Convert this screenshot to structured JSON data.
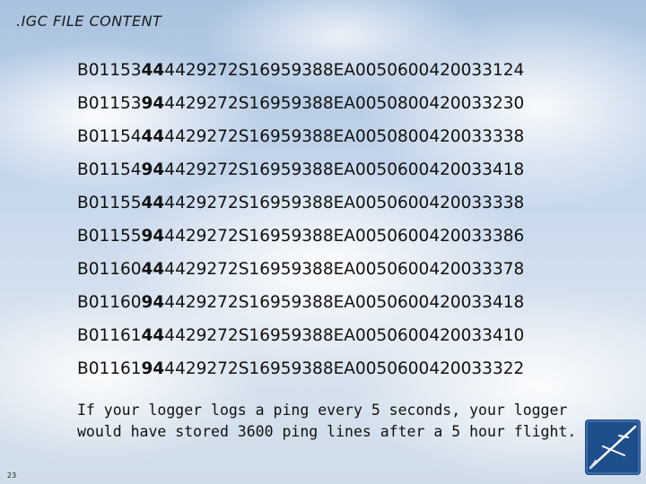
{
  "slide": {
    "title": ".IGC FILE CONTENT",
    "records": [
      {
        "prefix": "B01153",
        "bold": "44",
        "suffix": "4429272S16959388EA0050600420033124"
      },
      {
        "prefix": "B01153",
        "bold": "94",
        "suffix": "4429272S16959388EA0050800420033230"
      },
      {
        "prefix": "B01154",
        "bold": "44",
        "suffix": "4429272S16959388EA0050800420033338"
      },
      {
        "prefix": "B01154",
        "bold": "94",
        "suffix": "4429272S16959388EA0050600420033418"
      },
      {
        "prefix": "B01155",
        "bold": "44",
        "suffix": "4429272S16959388EA0050600420033338"
      },
      {
        "prefix": "B01155",
        "bold": "94",
        "suffix": "4429272S16959388EA0050600420033386"
      },
      {
        "prefix": "B01160",
        "bold": "44",
        "suffix": "4429272S16959388EA0050600420033378"
      },
      {
        "prefix": "B01160",
        "bold": "94",
        "suffix": "4429272S16959388EA0050600420033418"
      },
      {
        "prefix": "B01161",
        "bold": "44",
        "suffix": "4429272S16959388EA0050600420033410"
      },
      {
        "prefix": "B01161",
        "bold": "94",
        "suffix": "4429272S16959388EA0050600420033322"
      }
    ],
    "note_line1": "If your logger logs a ping every 5 seconds, your logger",
    "note_line2": "would have stored 3600 ping lines after a 5 hour flight.",
    "slide_number": "23",
    "logo_icon": "glider-logo-icon",
    "colors": {
      "logo_bg": "#1f4e8c",
      "text": "#111111"
    }
  }
}
